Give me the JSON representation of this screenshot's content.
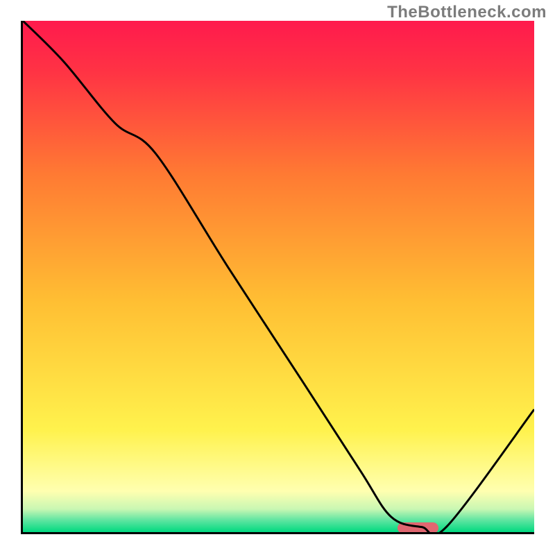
{
  "watermark": "TheBottleneck.com",
  "chart_data": {
    "type": "line",
    "title": "",
    "xlabel": "",
    "ylabel": "",
    "xlim": [
      0,
      100
    ],
    "ylim": [
      0,
      100
    ],
    "grid": false,
    "background_gradient_stops": [
      {
        "offset": 0.0,
        "color": "#ff1a4d"
      },
      {
        "offset": 0.1,
        "color": "#ff3344"
      },
      {
        "offset": 0.3,
        "color": "#ff7a33"
      },
      {
        "offset": 0.55,
        "color": "#ffbf33"
      },
      {
        "offset": 0.8,
        "color": "#fff24d"
      },
      {
        "offset": 0.92,
        "color": "#ffffb0"
      },
      {
        "offset": 0.955,
        "color": "#c9f7b3"
      },
      {
        "offset": 0.975,
        "color": "#66e6a3"
      },
      {
        "offset": 1.0,
        "color": "#00d980"
      }
    ],
    "series": [
      {
        "name": "bottleneck-curve",
        "color": "#000000",
        "x": [
          0,
          8,
          18,
          26,
          40,
          55,
          66,
          72,
          78,
          83,
          100
        ],
        "y": [
          100,
          92,
          80,
          74,
          52,
          29,
          12,
          3,
          1.0,
          1.2,
          24
        ]
      }
    ],
    "marker": {
      "name": "optimal-range",
      "color": "#e06670",
      "x_start": 73,
      "x_end": 81,
      "y": 1.2
    }
  }
}
